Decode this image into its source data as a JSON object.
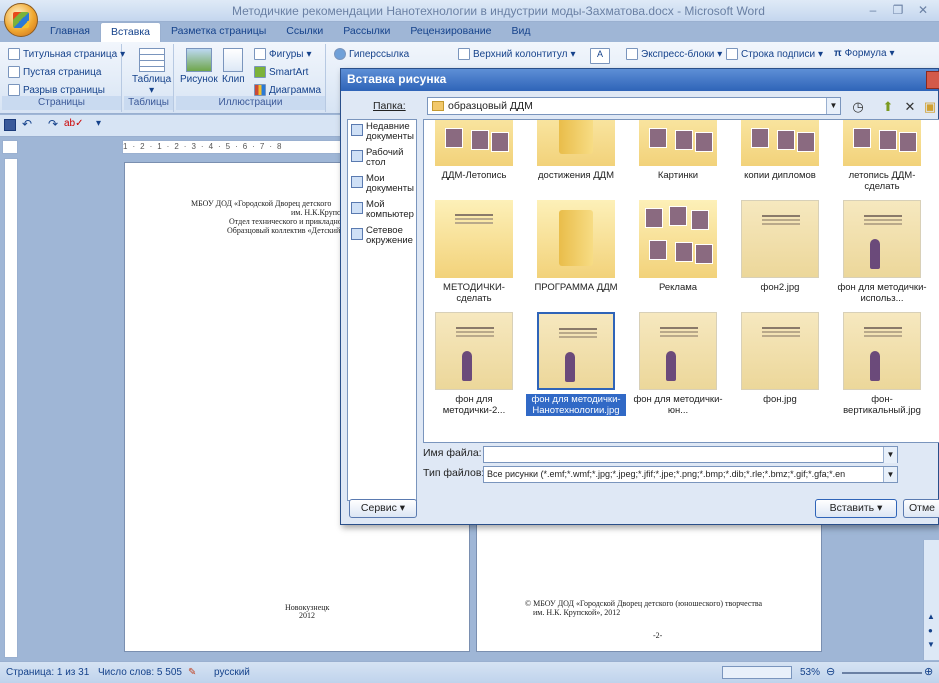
{
  "window": {
    "title": "Методичкие рекомендации Нанотехнологии в индустрии моды-Захматова.docx - Microsoft Word"
  },
  "tabs": [
    "Главная",
    "Вставка",
    "Разметка страницы",
    "Ссылки",
    "Рассылки",
    "Рецензирование",
    "Вид"
  ],
  "ribbon": {
    "pages": {
      "items": [
        "Титульная страница",
        "Пустая страница",
        "Разрыв страницы"
      ],
      "label": "Страницы"
    },
    "tables": {
      "item": "Таблица",
      "label": "Таблицы"
    },
    "illustrations": {
      "picture": "Рисунок",
      "clip": "Клип",
      "shapes": "Фигуры",
      "smartart": "SmartArt",
      "chart": "Диаграмма",
      "label": "Иллюстрации"
    },
    "hyperlink": "Гиперссылка",
    "header": "Верхний колонтитул",
    "express": "Экспресс-блоки",
    "signature": "Строка подписи",
    "formula": "Формула"
  },
  "ruler": {
    "marks": "1·2·1·2·3·4·5·6·7·8"
  },
  "pages": {
    "p1_header": [
      "МБОУ ДОД «Городской Дворец детского",
      "им. Н.К.Крупской»",
      "Отдел технического и прикладно",
      "Образцовый коллектив «Детский"
    ],
    "p1_footer": [
      "Новокузнецк",
      "2012"
    ],
    "p2_footer": [
      "© МБОУ ДОД «Городской Дворец детского (юношеского) творчества",
      "им. Н.К. Крупской», 2012"
    ],
    "p2_pagenum": "-2-"
  },
  "dialog": {
    "title": "Вставка рисунка",
    "folder_label": "Папка:",
    "folder_value": "образцовый ДДМ",
    "places": [
      "Недавние документы",
      "Рабочий стол",
      "Мои документы",
      "Мой компьютер",
      "Сетевое окружение"
    ],
    "files": [
      {
        "name": "ДДМ-Летопись",
        "kind": "folder-img"
      },
      {
        "name": "достижения ДДМ",
        "kind": "folder"
      },
      {
        "name": "Картинки",
        "kind": "folder-img"
      },
      {
        "name": "копии дипломов",
        "kind": "folder-img"
      },
      {
        "name": "летопись ДДМ-сделать",
        "kind": "folder-img"
      },
      {
        "name": "МЕТОДИЧКИ-сделать",
        "kind": "folder-doc"
      },
      {
        "name": "ПРОГРАММА ДДМ",
        "kind": "folder"
      },
      {
        "name": "Реклама",
        "kind": "folder-img"
      },
      {
        "name": "фон2.jpg",
        "kind": "image"
      },
      {
        "name": "фон для методички-использ...",
        "kind": "image"
      },
      {
        "name": "фон для методички-2...",
        "kind": "image"
      },
      {
        "name": "фон для методички-Нанотехнологии.jpg",
        "kind": "image",
        "selected": true
      },
      {
        "name": "фон для методички-юн...",
        "kind": "image"
      },
      {
        "name": "фон.jpg",
        "kind": "image"
      },
      {
        "name": "фон-вертикальный.jpg",
        "kind": "image"
      }
    ],
    "filename_label": "Имя файла:",
    "filename_value": "",
    "filetype_label": "Тип файлов:",
    "filetype_value": "Все рисунки (*.emf;*.wmf;*.jpg;*.jpeg;*.jfif;*.jpe;*.png;*.bmp;*.dib;*.rle;*.bmz;*.gif;*.gfa;*.en",
    "service": "Сервис",
    "insert": "Вставить",
    "cancel": "Отме"
  },
  "status": {
    "page": "Страница: 1 из 31",
    "words": "Число слов: 5 505",
    "lang": "русский",
    "zoom": "53%"
  }
}
